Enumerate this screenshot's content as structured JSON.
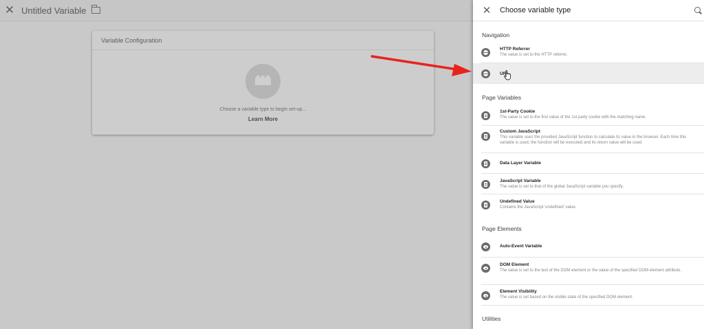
{
  "editor": {
    "title": "Untitled Variable",
    "close_icon": "close-icon",
    "folder_icon": "folder-icon",
    "card": {
      "header": "Variable Configuration",
      "hint": "Choose a variable type to begin set-up...",
      "learn_more": "Learn More",
      "icon": "lego-brick-icon"
    }
  },
  "panel": {
    "title": "Choose variable type",
    "close_icon": "close-icon",
    "search_icon": "search-icon",
    "sections": [
      {
        "title": "Navigation",
        "items": [
          {
            "name": "HTTP Referrer",
            "desc": "The value is set to the HTTP referrer.",
            "icon": "globe-icon"
          },
          {
            "name": "URL",
            "desc": "",
            "icon": "globe-icon"
          }
        ]
      },
      {
        "title": "Page Variables",
        "items": [
          {
            "name": "1st-Party Cookie",
            "desc": "The value is set to the first value of the 1st party cookie with the matching name.",
            "icon": "document-icon"
          },
          {
            "name": "Custom JavaScript",
            "desc": "This variable uses the provided JavaScript function to calculate its value in the browser. Each time this variable is used, the function will be executed and its return value will be used.",
            "icon": "document-icon"
          },
          {
            "name": "Data Layer Variable",
            "desc": "",
            "icon": "document-icon"
          },
          {
            "name": "JavaScript Variable",
            "desc": "The value is set to that of the global JavaScript variable you specify.",
            "icon": "document-icon"
          },
          {
            "name": "Undefined Value",
            "desc": "Contains the JavaScript 'undefined' value.",
            "icon": "document-icon"
          }
        ]
      },
      {
        "title": "Page Elements",
        "items": [
          {
            "name": "Auto-Event Variable",
            "desc": "",
            "icon": "eye-icon"
          },
          {
            "name": "DOM Element",
            "desc": "The value is set to the text of the DOM element or the value of the specified DOM element attribute.",
            "icon": "eye-icon"
          },
          {
            "name": "Element Visibility",
            "desc": "The value is set based on the visible state of the specified DOM element.",
            "icon": "eye-icon"
          }
        ]
      },
      {
        "title": "Utilities",
        "items": []
      }
    ]
  },
  "colors": {
    "overlay": "#c9c9c9",
    "arrow": "#e8231e",
    "highlight_row": "#ededed"
  }
}
